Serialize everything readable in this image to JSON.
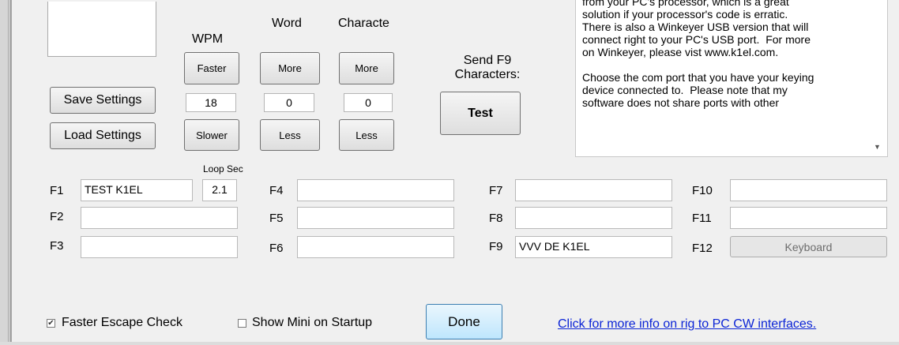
{
  "settings": {
    "save_label": "Save Settings",
    "load_label": "Load Settings"
  },
  "speed": {
    "wpm": {
      "title": "WPM",
      "up_label": "Faster",
      "value": "18",
      "down_label": "Slower"
    },
    "word": {
      "title": "Word",
      "up_label": "More",
      "value": "0",
      "down_label": "Less"
    },
    "character": {
      "title": "Characte",
      "up_label": "More",
      "value": "0",
      "down_label": "Less"
    }
  },
  "send_f9": {
    "label_line1": "Send F9",
    "label_line2": "Characters:",
    "button_label": "Test"
  },
  "info_text": "from your PC's processor, which is a great\nsolution if your processor's code is erratic.\nThere is also a Winkeyer USB version that will\nconnect right to your PC's USB port.  For more\non Winkeyer, please vist www.k1el.com.\n\nChoose the com port that you have your keying\ndevice connected to.  Please note that my\nsoftware does not share ports with other",
  "loop_sec": {
    "label": "Loop Sec",
    "value": "2.1"
  },
  "function_keys": {
    "f1": {
      "label": "F1",
      "value": "TEST K1EL"
    },
    "f2": {
      "label": "F2",
      "value": ""
    },
    "f3": {
      "label": "F3",
      "value": ""
    },
    "f4": {
      "label": "F4",
      "value": ""
    },
    "f5": {
      "label": "F5",
      "value": ""
    },
    "f6": {
      "label": "F6",
      "value": ""
    },
    "f7": {
      "label": "F7",
      "value": ""
    },
    "f8": {
      "label": "F8",
      "value": ""
    },
    "f9": {
      "label": "F9",
      "value": "VVV DE K1EL"
    },
    "f10": {
      "label": "F10",
      "value": ""
    },
    "f11": {
      "label": "F11",
      "value": ""
    },
    "f12": {
      "label": "F12",
      "button_label": "Keyboard"
    }
  },
  "options": {
    "faster_escape": {
      "label": "Faster Escape Check",
      "checked": true
    },
    "show_mini": {
      "label": "Show Mini on Startup",
      "checked": false
    }
  },
  "done_label": "Done",
  "info_link": "Click for more info on rig to PC CW interfaces.",
  "icons": {
    "checkbox_checked": "check-icon",
    "scroll_down": "scroll-down-arrow-icon"
  },
  "colors": {
    "link": "#0b24d6",
    "background": "#f0f0f0"
  }
}
